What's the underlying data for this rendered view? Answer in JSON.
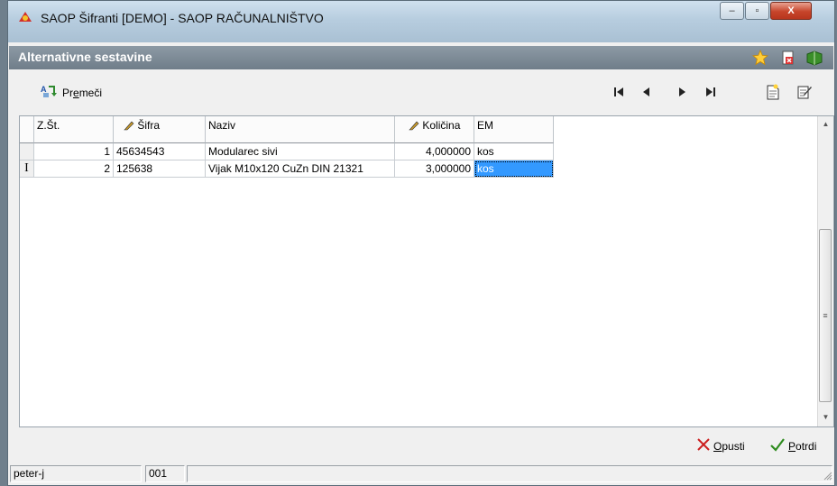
{
  "window": {
    "title": "SAOP Šifranti [DEMO] - SAOP RAČUNALNIŠTVO",
    "minimize": "‒",
    "maximize": "▫",
    "close": "X"
  },
  "form": {
    "title": "Alternativne sestavine"
  },
  "toolbar": {
    "move_prefix": "Pr",
    "move_accel": "e",
    "move_suffix": "meči"
  },
  "grid": {
    "columns": [
      "",
      "Z.Št.",
      "Šifra",
      "Naziv",
      "Količina",
      "EM"
    ],
    "rows": [
      {
        "marker": "",
        "zst": "1",
        "sifra": "45634543",
        "naziv": "Modularec sivi",
        "kolicina": "4,000000",
        "em": "kos"
      },
      {
        "marker": "I",
        "zst": "2",
        "sifra": "125638",
        "naziv": "Vijak M10x120 CuZn DIN 21321",
        "kolicina": "3,000000",
        "em": "kos"
      }
    ],
    "scroll_grip": "≡",
    "scroll_up": "▲",
    "scroll_down": "▼"
  },
  "footer": {
    "cancel_accel": "O",
    "cancel_rest": "pusti",
    "confirm_accel": "P",
    "confirm_rest": "otrdi"
  },
  "status": {
    "user": "peter-j",
    "code": "001"
  },
  "colors": {
    "selection": "#3399ff",
    "subbar": "#7b8893",
    "accent_red": "#cc1f1f",
    "accent_green": "#2e8b1e"
  }
}
